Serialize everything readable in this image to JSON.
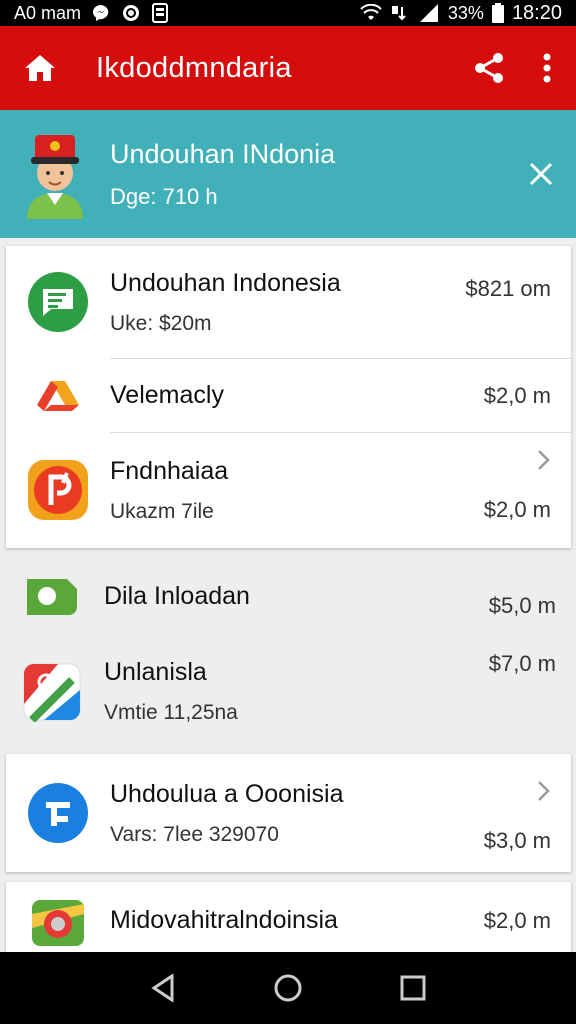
{
  "status_bar": {
    "carrier": "A0 mam",
    "battery_pct": "33%",
    "time": "18:20",
    "icons": [
      "messenger-icon",
      "refresh-icon",
      "sim-icon",
      "wifi-icon",
      "data-icon",
      "signal-icon",
      "battery-icon"
    ]
  },
  "app_bar": {
    "title": "Ikdoddmndaria",
    "icons": [
      "home-icon",
      "share-icon",
      "more-vert-icon"
    ],
    "color": "#d50d0d"
  },
  "banner": {
    "title": "Undouhan INdonia",
    "subtitle": "Dge: 710 h",
    "color": "#41b0b8",
    "icons": [
      "guard-avatar-icon",
      "close-icon"
    ]
  },
  "items": [
    {
      "name": "Undouhan Indonesia",
      "sub": "Uke: $20m",
      "price": "$821 om",
      "icon": "chat-app-icon"
    },
    {
      "name": "Velemacly",
      "sub": "",
      "price": "$2,0 m",
      "icon": "drive-app-icon"
    },
    {
      "name": "Fndnhaiaa",
      "sub": "Ukazm 7ile",
      "price": "$2,0 m",
      "icon": "pdf-app-icon"
    },
    {
      "name": "Dila Inloadan",
      "sub": "",
      "price": "$5,0 m",
      "icon": "camera-app-icon"
    },
    {
      "name": "Unlanisla",
      "sub": "Vmtie 11,25na",
      "price": "$7,0 m",
      "icon": "maps-app-icon"
    },
    {
      "name": "Uhdoulua a Ooonisia",
      "sub": "Vars: 7lee 329070",
      "price": "$3,0 m",
      "icon": "blue-app-icon"
    },
    {
      "name": "Midovahitralndoinsia",
      "sub": "",
      "price": "$2,0 m",
      "icon": "maps-pin-app-icon"
    }
  ],
  "nav_bar": {
    "icons": [
      "back-icon",
      "home-circle-icon",
      "recents-icon"
    ]
  }
}
